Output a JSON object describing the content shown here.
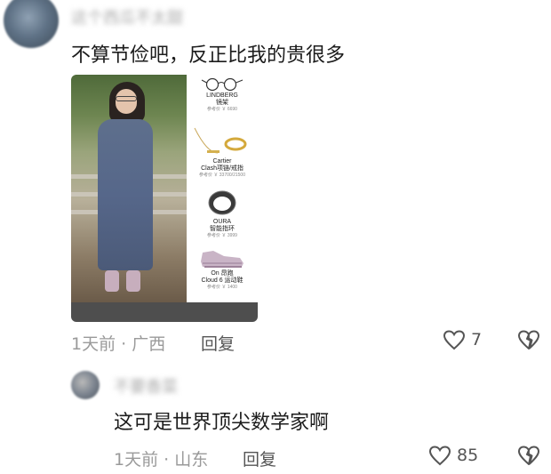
{
  "comments": [
    {
      "username": "这个西瓜不太甜",
      "text": "不算节俭吧，反正比我的贵很多",
      "meta": "1天前 · 广西",
      "reply_label": "回复",
      "like_count": "7",
      "image": {
        "items": [
          {
            "brand": "LINDBERG",
            "subtitle": "镜架",
            "price": "参考价 ￥ 6690",
            "icon": "glasses-icon"
          },
          {
            "brand": "Cartier",
            "subtitle": "Clash项链/戒指",
            "price": "参考价 ￥ 33700/21500",
            "icon": "jewelry-icon"
          },
          {
            "brand": "OURA",
            "subtitle": "智能指环",
            "price": "参考价 ￥ 3999",
            "icon": "ring-icon"
          },
          {
            "brand": "On 昂跑",
            "subtitle": "Cloud 6 运动鞋",
            "price": "参考价 ￥ 1400",
            "icon": "sneaker-icon"
          }
        ]
      }
    },
    {
      "username": "不要香菜",
      "text": "这可是世界顶尖数学家啊",
      "meta": "1天前 · 山东",
      "reply_label": "回复",
      "like_count": "85"
    }
  ],
  "colors": {
    "text": "#1c1c1c",
    "meta": "#9a9a9a",
    "icon": "#555555"
  }
}
